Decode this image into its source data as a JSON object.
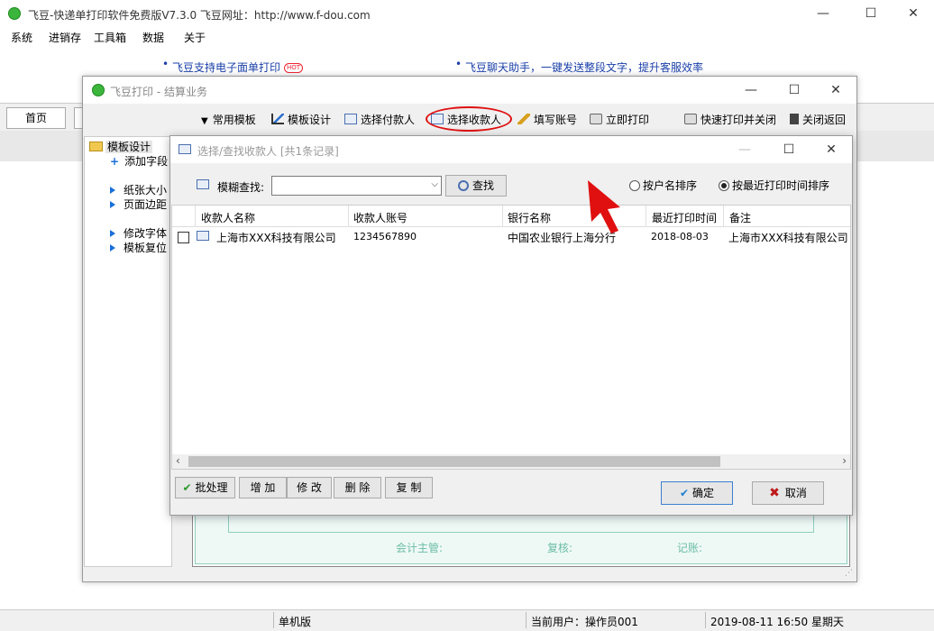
{
  "main": {
    "title": "飞豆-快递单打印软件免费版V7.3.0  飞豆网址：http://www.f-dou.com",
    "menu": [
      "系统",
      "进销存",
      "工具箱",
      "数据",
      "关于"
    ],
    "ads": [
      "飞豆支持电子面单打印",
      "飞豆聊天助手，一键发送整段文字，提升客服效率"
    ],
    "hot_badge": "HOT",
    "tab_home": "首页"
  },
  "settle_window": {
    "title": "飞豆打印 - 结算业务",
    "toolbar": [
      "常用模板",
      "模板设计",
      "选择付款人",
      "选择收款人",
      "填写账号",
      "立即打印",
      "快速打印并关闭",
      "关闭返回"
    ],
    "tree_root": "模板设计",
    "tree_items": [
      "添加字段",
      "纸张大小",
      "页面边距",
      "修改字体",
      "模板复位"
    ],
    "preview_labels": [
      "会计主管:",
      "复核:",
      "记账:"
    ]
  },
  "dialog": {
    "title": "选择/查找收款人  [共1条记录]",
    "search_label": "模糊查找:",
    "search_value": "",
    "find_button": "查找",
    "sort_options": [
      "按户名排序",
      "按最近打印时间排序"
    ],
    "sort_selected": 1,
    "columns": [
      "收款人名称",
      "收款人账号",
      "银行名称",
      "最近打印时间",
      "备注"
    ],
    "rows": [
      {
        "checked": false,
        "cells": [
          "上海市XXX科技有限公司",
          "1234567890",
          "中国农业银行上海分行",
          "2018-08-03",
          "上海市XXX科技有限公司"
        ]
      }
    ],
    "buttons": [
      "批处理",
      "增 加",
      "修 改",
      "删 除",
      "复 制"
    ],
    "ok": "确定",
    "cancel": "取消"
  },
  "status": {
    "edition": "单机版",
    "user": "当前用户：操作员001",
    "datetime": "2019-08-11  16:50  星期天"
  },
  "colors": {
    "annotation": "#e01010",
    "ad_link": "#1a3fa8"
  }
}
